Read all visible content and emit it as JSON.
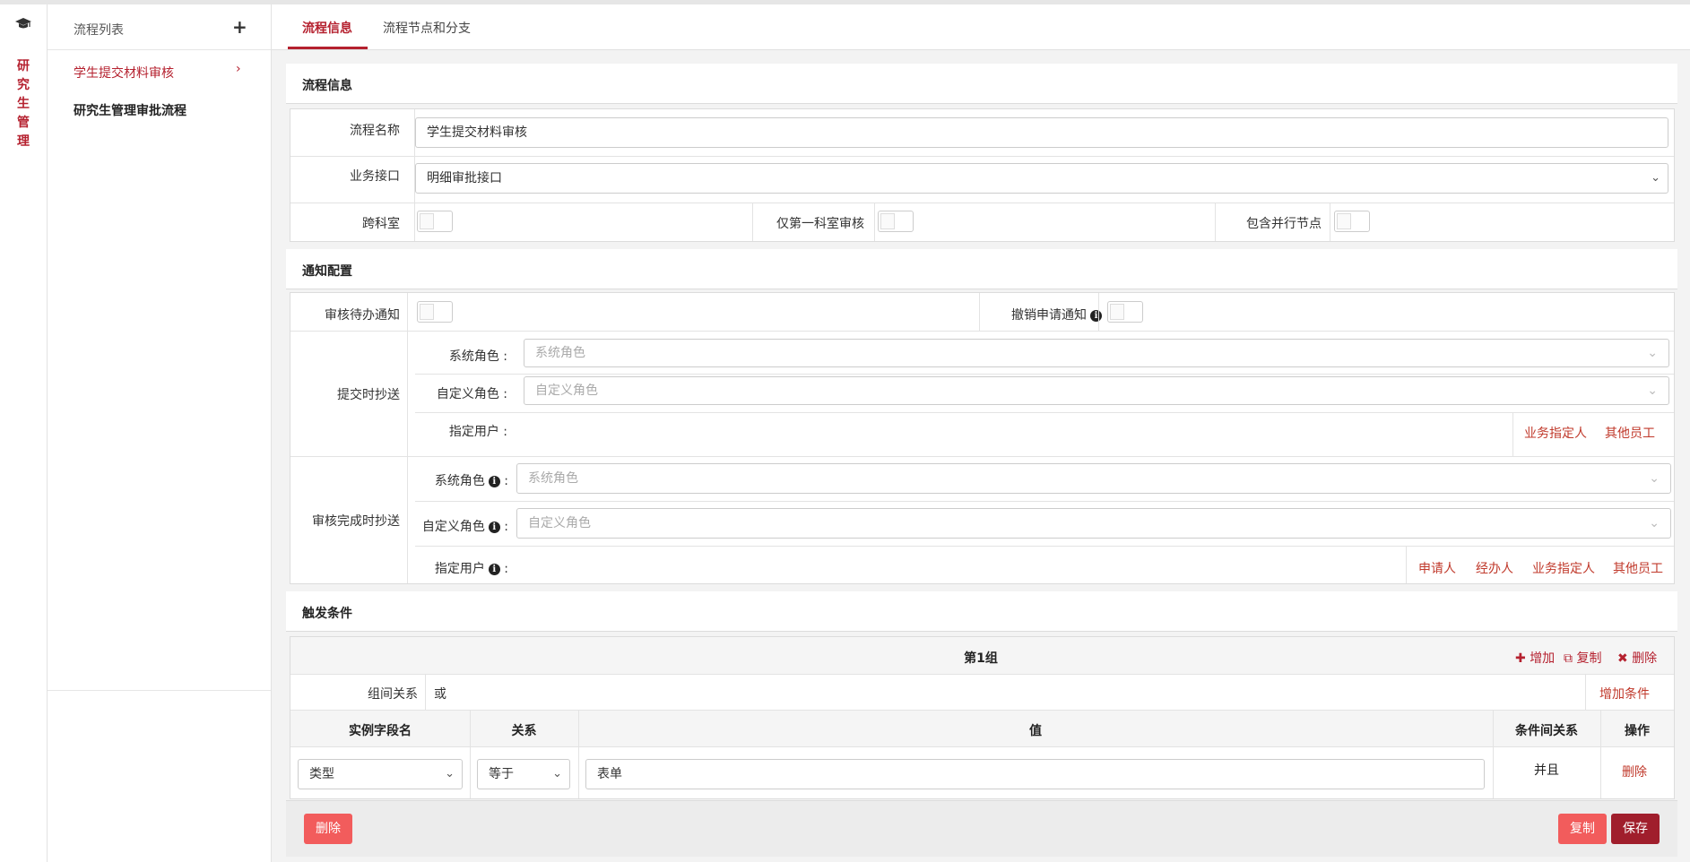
{
  "rail": {
    "label": [
      "研",
      "究",
      "生",
      "管",
      "理"
    ]
  },
  "list": {
    "title": "流程列表",
    "items": [
      {
        "label": "学生提交材料审核"
      },
      {
        "label": "研究生管理审批流程"
      }
    ]
  },
  "tabs": [
    {
      "label": "流程信息"
    },
    {
      "label": "流程节点和分支"
    }
  ],
  "info": {
    "section_title": "流程信息",
    "name_label": "流程名称",
    "name_value": "学生提交材料审核",
    "api_label": "业务接口",
    "api_value": "明细审批接口",
    "cross_label": "跨科室",
    "first_only_label": "仅第一科室审核",
    "parallel_label": "包含并行节点"
  },
  "notify": {
    "section_title": "通知配置",
    "pending_label": "审核待办通知",
    "revoke_label": "撤销申请通知",
    "submit_cc_label": "提交时抄送",
    "submit": {
      "sys_role_label": "系统角色 :",
      "sys_role_placeholder": "系统角色",
      "custom_role_label": "自定义角色 :",
      "custom_role_placeholder": "自定义角色",
      "user_label": "指定用户 :",
      "links": [
        "业务指定人",
        "其他员工"
      ]
    },
    "complete_cc_label": "审核完成时抄送",
    "complete": {
      "sys_role_label": "系统角色",
      "sys_role_placeholder": "系统角色",
      "custom_role_label": "自定义角色",
      "custom_role_placeholder": "自定义角色",
      "user_label": "指定用户",
      "links": [
        "申请人",
        "经办人",
        "业务指定人",
        "其他员工"
      ]
    }
  },
  "trigger": {
    "section_title": "触发条件",
    "group_title": "第1组",
    "group_actions": {
      "add": "增加",
      "copy": "复制",
      "delete": "删除"
    },
    "relation_label": "组间关系",
    "relation_value": "或",
    "add_condition": "增加条件",
    "columns": [
      "实例字段名",
      "关系",
      "值",
      "条件间关系",
      "操作"
    ],
    "row": {
      "field": "类型",
      "relation": "等于",
      "value": "表单",
      "logic": "并且",
      "action": "删除"
    }
  },
  "footer": {
    "delete": "删除",
    "copy": "复制",
    "save": "保存"
  },
  "colors": {
    "accent": "#b5212f",
    "button_red": "#f25c5c",
    "button_dark": "#a01e2c"
  }
}
